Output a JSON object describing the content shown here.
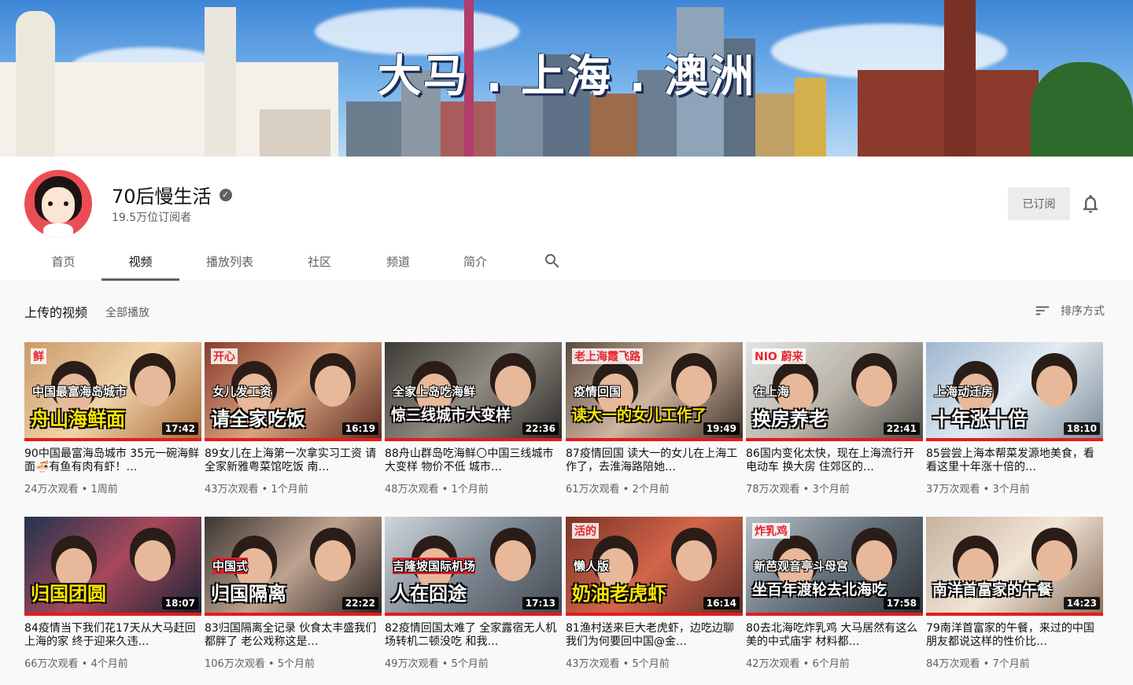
{
  "banner": {
    "title": "大马 . 上海 . 澳洲"
  },
  "channel": {
    "name": "70后慢生活",
    "subscribers": "19.5万位订阅者",
    "subscribe_label": "已订阅"
  },
  "tabs": [
    {
      "label": "首页"
    },
    {
      "label": "视频"
    },
    {
      "label": "播放列表"
    },
    {
      "label": "社区"
    },
    {
      "label": "频道"
    },
    {
      "label": "简介"
    }
  ],
  "section": {
    "title": "上传的视频",
    "play_all": "全部播放",
    "sort_label": "排序方式"
  },
  "videos": [
    {
      "title": "90中国最富海岛城市 35元一碗海鲜面🍜有鱼有肉有虾！…",
      "views": "24万次观看",
      "age": "1周前",
      "duration": "17:42",
      "caption": "舟山海鲜面",
      "caption2": "中国最富海岛城市",
      "tag": "鲜"
    },
    {
      "title": "89女儿在上海第一次拿实习工资 请全家新雅粤菜馆吃饭 南…",
      "views": "43万次观看",
      "age": "1个月前",
      "duration": "16:19",
      "caption": "请全家吃饭",
      "caption2": "女儿发工资",
      "tag": "开心"
    },
    {
      "title": "88舟山群岛吃海鲜🌕中国三线城市大变样 物价不低 城市…",
      "views": "48万次观看",
      "age": "1个月前",
      "duration": "22:36",
      "caption": "惊三线城市大变样",
      "caption2": "全家上岛吃海鲜",
      "tag": ""
    },
    {
      "title": "87疫情回国 读大一的女儿在上海工作了，去淮海路陪她…",
      "views": "61万次观看",
      "age": "2个月前",
      "duration": "19:49",
      "caption": "读大一的女儿工作了",
      "caption2": "疫情回国",
      "tag": "老上海霞飞路"
    },
    {
      "title": "86国内变化太快，现在上海流行开电动车 换大房 住郊区的…",
      "views": "78万次观看",
      "age": "3个月前",
      "duration": "22:41",
      "caption": "换房养老",
      "caption2": "在上海",
      "tag": "NIO 蔚来"
    },
    {
      "title": "85尝尝上海本帮菜发源地美食，看看这里十年涨十倍的…",
      "views": "37万次观看",
      "age": "3个月前",
      "duration": "18:10",
      "caption": "十年涨十倍",
      "caption2": "上海动迁房",
      "tag": ""
    },
    {
      "title": "84疫情当下我们花17天从大马赶回上海的家 终于迎来久违…",
      "views": "66万次观看",
      "age": "4个月前",
      "duration": "18:07",
      "caption": "归国团圆",
      "caption2": "",
      "tag": ""
    },
    {
      "title": "83归国隔离全记录 伙食太丰盛我们都胖了 老公戏称这是…",
      "views": "106万次观看",
      "age": "5个月前",
      "duration": "22:22",
      "caption": "归国隔离",
      "caption2": "中国式",
      "tag": ""
    },
    {
      "title": "82疫情回国太难了 全家露宿无人机场转机二顿没吃 和我…",
      "views": "49万次观看",
      "age": "5个月前",
      "duration": "17:13",
      "caption": "人在囧途",
      "caption2": "吉隆坡国际机场",
      "tag": ""
    },
    {
      "title": "81渔村送来巨大老虎虾，边吃边聊我们为何要回中国@金…",
      "views": "43万次观看",
      "age": "5个月前",
      "duration": "16:14",
      "caption": "奶油老虎虾",
      "caption2": "懒人版",
      "tag": "活的"
    },
    {
      "title": "80去北海吃炸乳鸡 大马居然有这么美的中式庙宇 材料都…",
      "views": "42万次观看",
      "age": "6个月前",
      "duration": "17:58",
      "caption": "坐百年渡轮去北海吃",
      "caption2": "新芭观音亭斗母宫",
      "tag": "炸乳鸡"
    },
    {
      "title": "79南洋首富家的午餐，来过的中国朋友都说这样的性价比…",
      "views": "84万次观看",
      "age": "7个月前",
      "duration": "14:23",
      "caption": "南洋首富家的午餐",
      "caption2": "",
      "tag": ""
    }
  ],
  "colors": {
    "accent": "#e61b1b",
    "caption_yellow": "#ffe600",
    "caption_red": "#e8232a"
  }
}
